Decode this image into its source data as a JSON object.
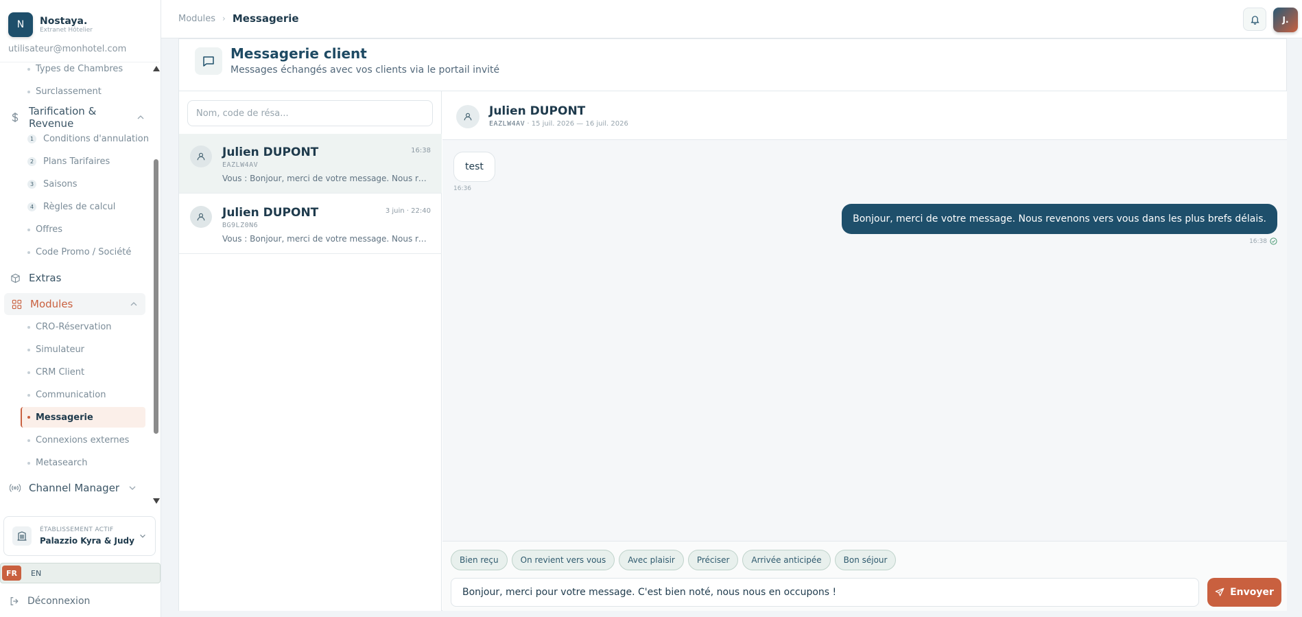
{
  "brand": {
    "initial": "N",
    "name": "Nostaya.",
    "subtitle": "Extranet Hôtelier"
  },
  "user": {
    "email": "utilisateur@monhotel.com"
  },
  "sidebar": {
    "top_subitems": [
      "Types de Chambres",
      "Surclassement"
    ],
    "tarification": {
      "label": "Tarification & Revenue",
      "items": [
        {
          "num": "1",
          "label": "Conditions d'annulation"
        },
        {
          "num": "2",
          "label": "Plans Tarifaires"
        },
        {
          "num": "3",
          "label": "Saisons"
        },
        {
          "num": "4",
          "label": "Règles de calcul"
        }
      ],
      "plain_items": [
        "Offres",
        "Code Promo / Société"
      ]
    },
    "extras": {
      "label": "Extras"
    },
    "modules": {
      "label": "Modules",
      "items": [
        "CRO-Réservation",
        "Simulateur",
        "CRM Client",
        "Communication",
        "Messagerie",
        "Connexions externes",
        "Metasearch"
      ]
    },
    "channel": {
      "label": "Channel Manager"
    },
    "establishment": {
      "label": "ÉTABLISSEMENT ACTIF",
      "name": "Palazzio Kyra & Judy"
    },
    "lang": {
      "active": "FR",
      "other": "EN"
    },
    "logout": "Déconnexion"
  },
  "topbar": {
    "breadcrumb_parent": "Modules",
    "breadcrumb_sep": "›",
    "breadcrumb_current": "Messagerie",
    "avatar": "J."
  },
  "page": {
    "title": "Messagerie client",
    "subtitle": "Messages échangés avec vos clients via le portail invité"
  },
  "search": {
    "placeholder": "Nom, code de résa..."
  },
  "conversations": [
    {
      "name": "Julien DUPONT",
      "code": "EAZLW4AV",
      "time": "16:38",
      "preview": "Vous : Bonjour, merci de votre message. Nous revenons vers vous dans les plus brefs délais."
    },
    {
      "name": "Julien DUPONT",
      "code": "BG9LZ0N6",
      "time": "3 juin · 22:40",
      "preview": "Vous : Bonjour, merci de votre message. Nous revenons vers vous dans les plus brefs délais."
    }
  ],
  "chat": {
    "name": "Julien DUPONT",
    "code": "EAZLW4AV",
    "dates": "· 15 juil. 2026 — 16 juil. 2026",
    "messages": [
      {
        "direction": "in",
        "text": "test",
        "time": "16:36"
      },
      {
        "direction": "out",
        "text": "Bonjour, merci de votre message. Nous revenons vers vous dans les plus brefs délais.",
        "time": "16:38"
      }
    ]
  },
  "quick_replies": [
    "Bien reçu",
    "On revient vers vous",
    "Avec plaisir",
    "Préciser",
    "Arrivée anticipée",
    "Bon séjour"
  ],
  "composer": {
    "value": "Bonjour, merci pour votre message. C'est bien noté, nous nous en occupons !",
    "send_label": "Envoyer"
  },
  "colors": {
    "primary": "#1e4f6b",
    "accent": "#c9603f",
    "chip_bg": "#e8f0ed"
  }
}
